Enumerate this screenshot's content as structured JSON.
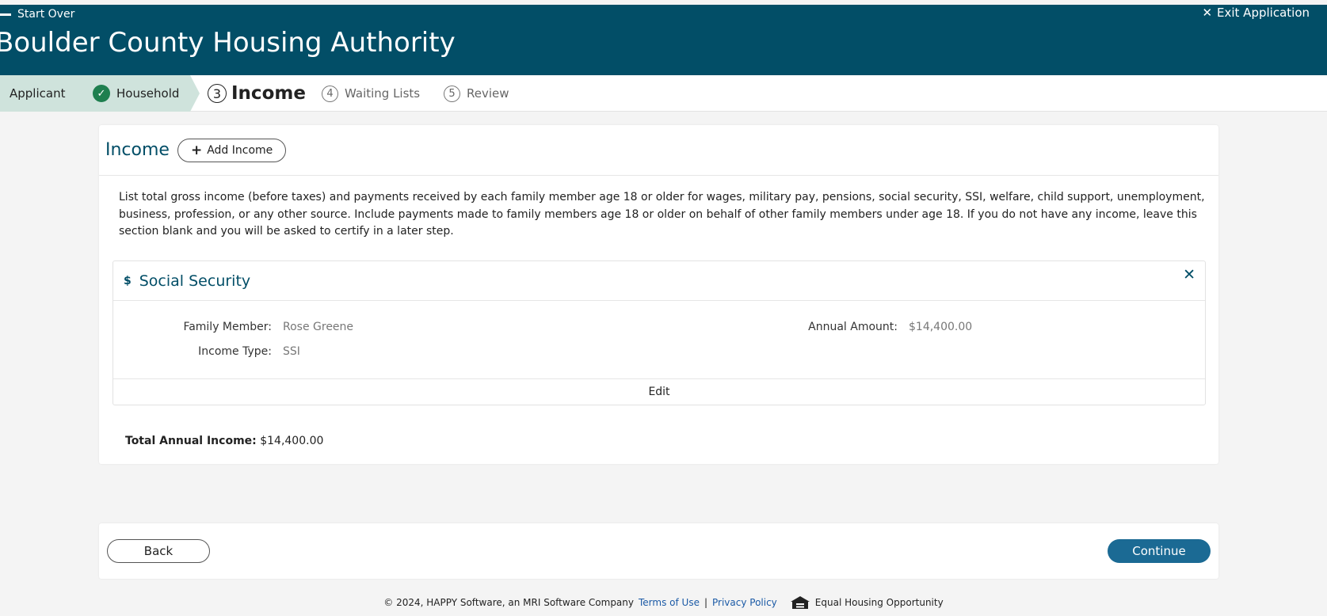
{
  "header": {
    "start_over": "Start Over",
    "exit_application": "Exit Application",
    "title": "Boulder County Housing Authority"
  },
  "stepper": {
    "steps": [
      {
        "label": "Applicant",
        "state": "done"
      },
      {
        "label": "Household",
        "state": "done"
      },
      {
        "number": "3",
        "label": "Income",
        "state": "current"
      },
      {
        "number": "4",
        "label": "Waiting Lists",
        "state": "pending"
      },
      {
        "number": "5",
        "label": "Review",
        "state": "pending"
      }
    ]
  },
  "income_section": {
    "title": "Income",
    "add_button": "Add Income",
    "instructions": "List total gross income (before taxes) and payments received by each family member age 18 or older for wages, military pay, pensions, social security, SSI, welfare, child support, unemployment, business, profession, or any other source. Include payments made to family members age 18 or older on behalf of other family members under age 18. If you do not have any income, leave this section blank and you will be asked to certify in a later step.",
    "items": [
      {
        "icon": "$",
        "title": "Social Security",
        "family_member_label": "Family Member:",
        "family_member": "Rose Greene",
        "income_type_label": "Income Type:",
        "income_type": "SSI",
        "annual_amount_label": "Annual Amount:",
        "annual_amount": "$14,400.00",
        "edit_label": "Edit"
      }
    ],
    "total_label": "Total Annual Income:",
    "total_value": "$14,400.00"
  },
  "nav": {
    "back": "Back",
    "continue": "Continue"
  },
  "footer": {
    "copyright": "© 2024, HAPPY Software, an MRI Software Company",
    "terms": "Terms of Use",
    "separator": "|",
    "privacy": "Privacy Policy",
    "equal_housing": "Equal Housing Opportunity"
  },
  "colors": {
    "brand": "#024e67",
    "done_step_bg": "#cfe3dc",
    "check_green": "#1e7f4f",
    "continue_button": "#1b6a94",
    "link": "#1b5aa6"
  }
}
